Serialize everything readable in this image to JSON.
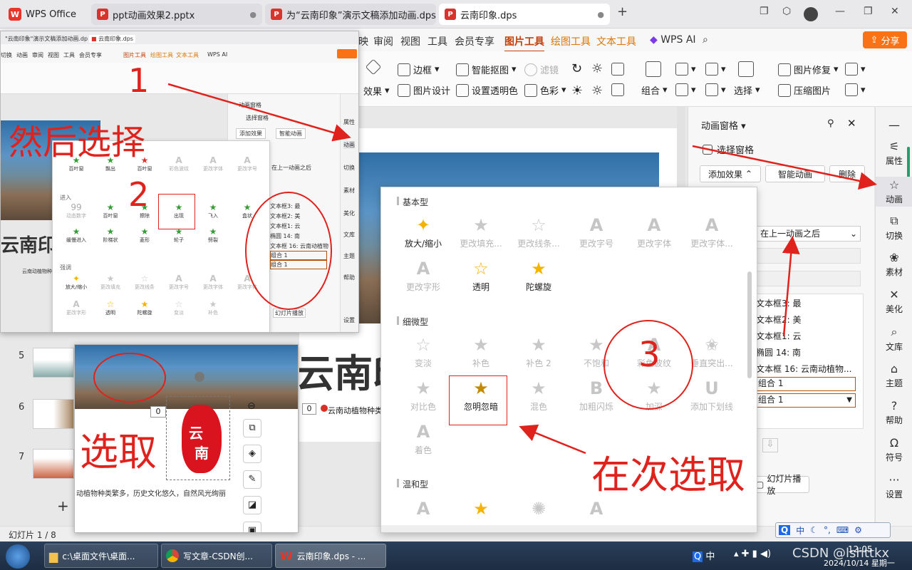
{
  "tabs": {
    "home": "WPS Office",
    "tab1": "ppt动画效果2.pptx",
    "tab2": "为“云南印象”演示文稿添加动画.dps",
    "tab3": "云南印象.dps",
    "add": "+"
  },
  "ribbon_tabs": [
    "映",
    "审阅",
    "视图",
    "工具",
    "会员专享",
    "图片工具",
    "绘图工具",
    "文本工具",
    "WPS AI"
  ],
  "share": "分享",
  "ribbon": {
    "border": "边框",
    "smart_crop": "智能抠图",
    "filter": "滤镜",
    "effect": "效果",
    "picture_design": "图片设计",
    "set_transparent": "设置透明色",
    "color": "色彩",
    "combine": "组合",
    "select": "选择",
    "pic_repair": "图片修复",
    "compress": "压缩图片"
  },
  "anim_pane": {
    "title": "动画窗格",
    "select_pane": "选择窗格",
    "add_effect": "添加效果",
    "smart_anim": "智能动画",
    "delete": "删除",
    "start": "在上一动画之后",
    "items": [
      "文本框3: 最",
      "文本框2: 美",
      "文本框1: 云",
      "椭圆 14: 南",
      "文本框 16: 云南动植物..."
    ],
    "boxes": [
      "组合 1",
      "组合 1"
    ],
    "play": "幻灯片播放"
  },
  "side_rail": [
    "属性",
    "动画",
    "切换",
    "素材",
    "美化",
    "文库",
    "主题",
    "帮助",
    "符号",
    "设置"
  ],
  "gallery": {
    "sections": {
      "basic": "基本型",
      "subtle": "细微型",
      "moderate": "温和型"
    },
    "basic": [
      "放大/缩小",
      "更改填充...",
      "更改线条...",
      "更改字号",
      "更改字体",
      "更改字体...",
      "更改字形",
      "透明",
      "陀螺旋"
    ],
    "subtle": [
      "变淡",
      "补色",
      "补色 2",
      "不饱和",
      "彩色波纹",
      "垂直突出...",
      "对比色",
      "忽明忽暗",
      "混色",
      "加粗闪烁",
      "加深",
      "添加下划线",
      "着色"
    ]
  },
  "slide": {
    "title_fragment": "云南印",
    "zero": "0",
    "caption": "云南动植物种类"
  },
  "overlay": {
    "tab_a": "\"云南印象\"演示文稿添加动画.dp",
    "tab_b": "云南印象.dps",
    "ribbon_tabs": [
      "切换",
      "动画",
      "审阅",
      "视图",
      "工具",
      "会员专享",
      "图片工具",
      "绘图工具",
      "文本工具",
      "WPS AI"
    ],
    "anim_title": "动画窗格",
    "select_pane": "选择窗格",
    "add_effect": "添加效果",
    "smart_anim": "智能动画",
    "start": "在上一动画之后",
    "section_enter": "进入",
    "section_emph": "强调",
    "row1": [
      "百叶窗",
      "飘出",
      "百叶窗",
      "彩色波纹",
      "更改字体",
      "更改字号"
    ],
    "enter": [
      "动态数字",
      "百叶窗",
      "擦除",
      "出现",
      "飞入",
      "盒状",
      "缓慢进入",
      "阶梯状",
      "菱形",
      "轮子",
      "劈裂"
    ],
    "emph": [
      "放大/缩小",
      "更改填充",
      "更改线条",
      "更改字号",
      "更改字体",
      "更改字体"
    ],
    "emph2": [
      "更改字形",
      "透明",
      "陀螺旋",
      "变淡",
      "补色"
    ],
    "list": [
      "文本框3: 最",
      "文本框2: 美",
      "文本框1: 云",
      "椭圆 14: 南",
      "文本框 16: 云南动植物",
      "组合 1",
      "组合 1"
    ],
    "side": [
      "属性",
      "动画",
      "切换",
      "素材",
      "美化",
      "文库",
      "主题",
      "帮助",
      "设置"
    ],
    "caption": "云南动植物种类",
    "play": "幻灯片播放"
  },
  "overlay2": {
    "seal_top": "云",
    "seal_bottom": "南",
    "zero": "0",
    "caption": "动植物种类繁多，历史文化悠久，自然风光绚丽"
  },
  "thumbnails": [
    "5",
    "6",
    "7"
  ],
  "annotations": {
    "n1": "1",
    "then_select": "然后选择",
    "n2": "2",
    "select_again": "在次选取",
    "circled3": "3",
    "select": "选取"
  },
  "status": {
    "slide": "幻灯片 1 / 8"
  },
  "taskbar": {
    "explorer": "c:\\桌面文件\\桌面...",
    "chrome": "写文章-CSDN创...",
    "wps": "云南印象.dps - ...",
    "ime": "中",
    "time": "12:05",
    "date": "2024/10/14 星期一",
    "watermark": "CSDN @lshttkx"
  },
  "ime_bar": "中",
  "colors": {
    "accent": "#c2410c",
    "share": "#f97316",
    "annotation": "#e0221d"
  }
}
